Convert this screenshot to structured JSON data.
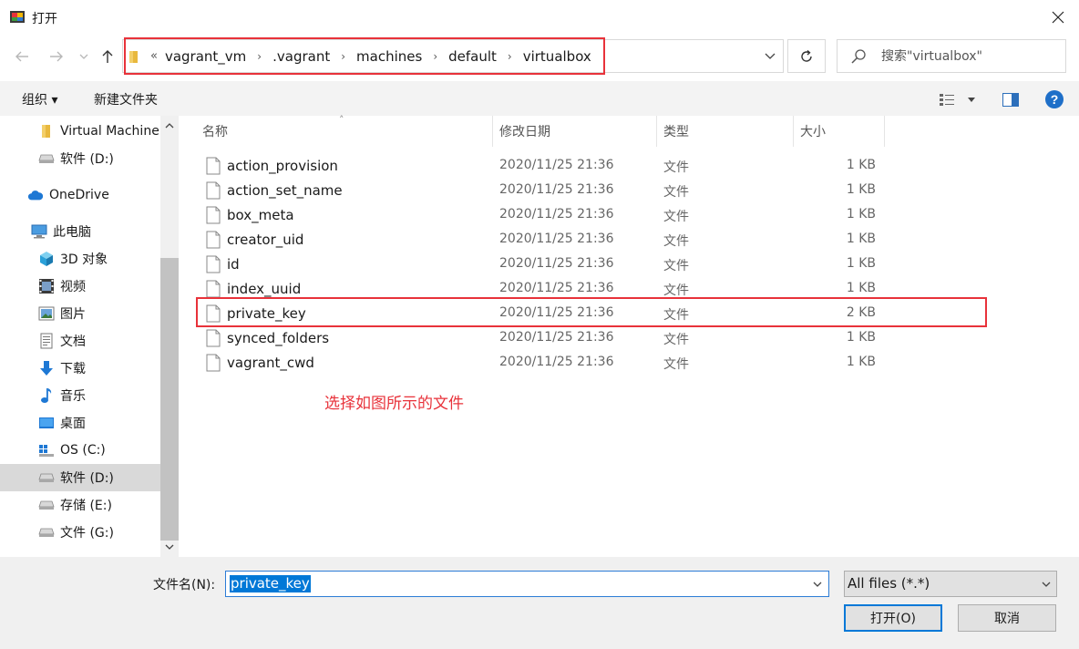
{
  "window": {
    "title": "打开"
  },
  "address": {
    "overflow": "«",
    "crumbs": [
      "vagrant_vm",
      ".vagrant",
      "machines",
      "default",
      "virtualbox"
    ]
  },
  "search": {
    "placeholder": "搜索\"virtualbox\""
  },
  "toolbar": {
    "organize": "组织 ▾",
    "new_folder": "新建文件夹"
  },
  "sidebar": {
    "items": [
      {
        "label": "Virtual Machine",
        "icon": "folder-icon"
      },
      {
        "label": "软件 (D:)",
        "icon": "drive-icon"
      },
      {
        "label": "OneDrive",
        "icon": "cloud-icon"
      },
      {
        "label": "此电脑",
        "icon": "computer-icon"
      },
      {
        "label": "3D 对象",
        "icon": "cube-icon"
      },
      {
        "label": "视频",
        "icon": "video-icon"
      },
      {
        "label": "图片",
        "icon": "picture-icon"
      },
      {
        "label": "文档",
        "icon": "document-icon"
      },
      {
        "label": "下载",
        "icon": "download-icon"
      },
      {
        "label": "音乐",
        "icon": "music-icon"
      },
      {
        "label": "桌面",
        "icon": "desktop-icon"
      },
      {
        "label": "OS (C:)",
        "icon": "windows-drive-icon"
      },
      {
        "label": "软件 (D:)",
        "icon": "drive-icon"
      },
      {
        "label": "存储 (E:)",
        "icon": "drive-icon"
      },
      {
        "label": "文件 (G:)",
        "icon": "drive-icon"
      }
    ]
  },
  "columns": {
    "name": "名称",
    "date": "修改日期",
    "type": "类型",
    "size": "大小"
  },
  "files": [
    {
      "name": "action_provision",
      "date": "2020/11/25 21:36",
      "type": "文件",
      "size": "1 KB"
    },
    {
      "name": "action_set_name",
      "date": "2020/11/25 21:36",
      "type": "文件",
      "size": "1 KB"
    },
    {
      "name": "box_meta",
      "date": "2020/11/25 21:36",
      "type": "文件",
      "size": "1 KB"
    },
    {
      "name": "creator_uid",
      "date": "2020/11/25 21:36",
      "type": "文件",
      "size": "1 KB"
    },
    {
      "name": "id",
      "date": "2020/11/25 21:36",
      "type": "文件",
      "size": "1 KB"
    },
    {
      "name": "index_uuid",
      "date": "2020/11/25 21:36",
      "type": "文件",
      "size": "1 KB"
    },
    {
      "name": "private_key",
      "date": "2020/11/25 21:36",
      "type": "文件",
      "size": "2 KB"
    },
    {
      "name": "synced_folders",
      "date": "2020/11/25 21:36",
      "type": "文件",
      "size": "1 KB"
    },
    {
      "name": "vagrant_cwd",
      "date": "2020/11/25 21:36",
      "type": "文件",
      "size": "1 KB"
    }
  ],
  "annotation": "选择如图所示的文件",
  "bottom": {
    "filename_label": "文件名(N):",
    "filename_value": "private_key",
    "filter": "All files (*.*)",
    "open_button": "打开(O)",
    "cancel_button": "取消"
  },
  "colors": {
    "accent": "#0078d7",
    "highlight": "#e8323a",
    "folder": "#e8b83e"
  }
}
